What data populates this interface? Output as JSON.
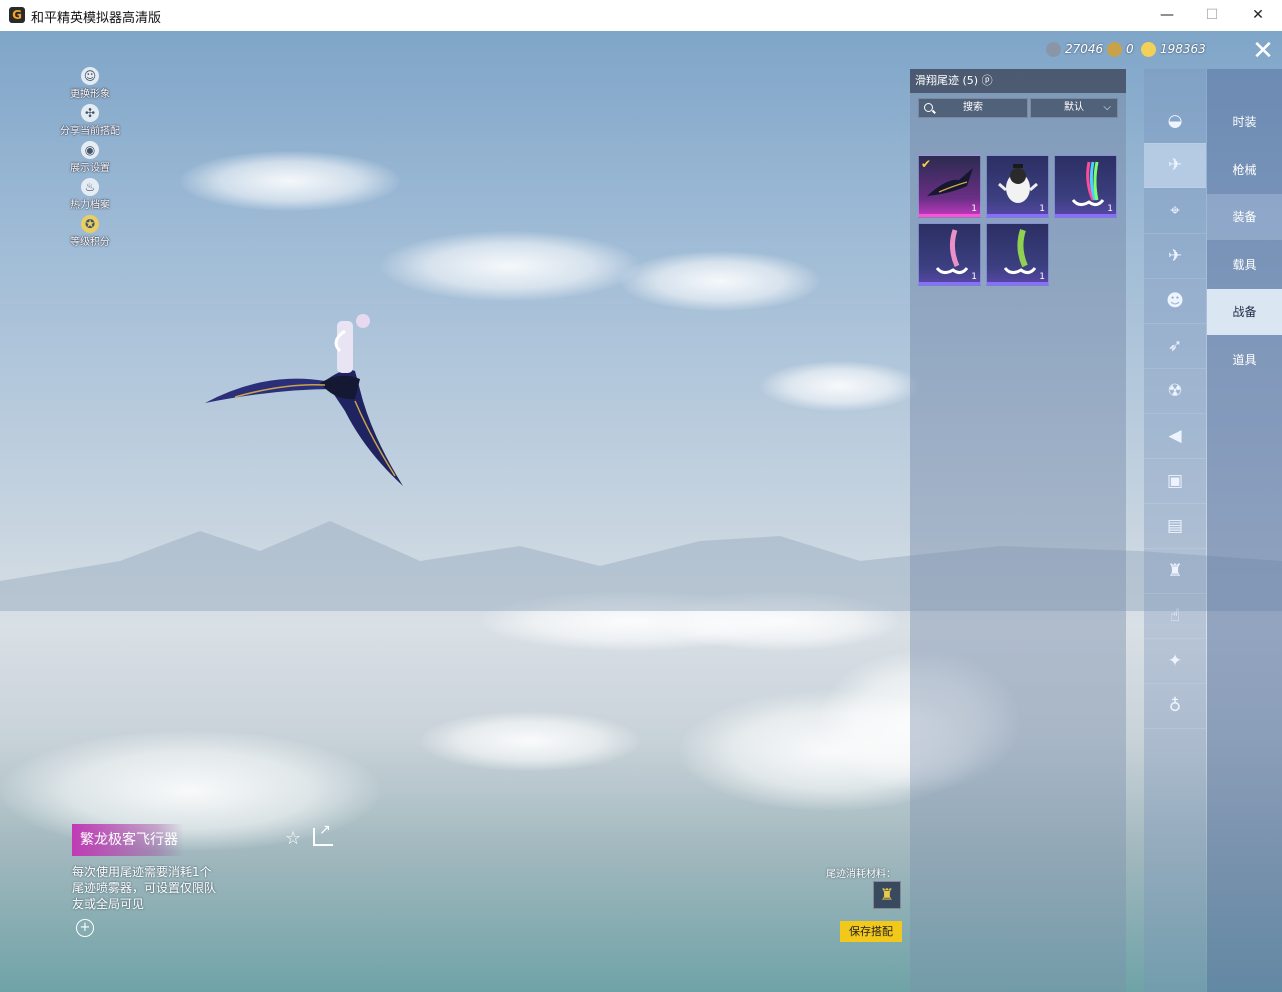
{
  "window": {
    "title": "和平精英模拟器高清版",
    "minimize": "—",
    "maximize": "☐",
    "close": "✕"
  },
  "left_menu": [
    {
      "label": "更换形象",
      "icon": "person-icon",
      "glyph": "☺"
    },
    {
      "label": "分享当前搭配",
      "icon": "share-icon",
      "glyph": "✣"
    },
    {
      "label": "展示设置",
      "icon": "eye-icon",
      "glyph": "◉"
    },
    {
      "label": "热力档案",
      "icon": "flame-icon",
      "glyph": "♨"
    },
    {
      "label": "等级积分",
      "icon": "badge-icon",
      "glyph": "✪"
    }
  ],
  "currency": [
    {
      "value": "27046",
      "color": "#8a96a8"
    },
    {
      "value": "0",
      "color": "#c8a24a"
    },
    {
      "value": "198363",
      "color": "#f1d157"
    }
  ],
  "panel": {
    "title": "滑翔尾迹 (5) ⓟ",
    "search_label": "搜索",
    "sort_label": "默认",
    "sort_chevron": "⌵",
    "items": [
      {
        "count": "1",
        "selected": true,
        "check": "✔"
      },
      {
        "count": "1",
        "selected": false
      },
      {
        "count": "1",
        "selected": false
      },
      {
        "count": "1",
        "selected": false
      },
      {
        "count": "1",
        "selected": false
      }
    ]
  },
  "categories": [
    {
      "icon": "hat-icon",
      "glyph": "◒"
    },
    {
      "icon": "glider-trail-icon",
      "glyph": "✈"
    },
    {
      "icon": "drone-icon",
      "glyph": "⌖"
    },
    {
      "icon": "plane-icon",
      "glyph": "✈"
    },
    {
      "icon": "emote-icon",
      "glyph": "☻"
    },
    {
      "icon": "vehicle-icon",
      "glyph": "➶"
    },
    {
      "icon": "companion-icon",
      "glyph": "☢"
    },
    {
      "icon": "speaker-icon",
      "glyph": "◀"
    },
    {
      "icon": "chat-icon",
      "glyph": "▣"
    },
    {
      "icon": "gallery-icon",
      "glyph": "▤"
    },
    {
      "icon": "extinguisher-icon",
      "glyph": "♜"
    },
    {
      "icon": "tap-icon",
      "glyph": "☝"
    },
    {
      "icon": "sparkle-icon",
      "glyph": "✦"
    },
    {
      "icon": "planet-icon",
      "glyph": "♁"
    }
  ],
  "tabs": [
    "时装",
    "枪械",
    "装备",
    "载具",
    "战备",
    "道具"
  ],
  "close_button": "✕",
  "item_detail": {
    "name": "繁龙极客飞行器",
    "description": "每次使用尾迹需要消耗1个尾迹喷雾器，可设置仅限队友或全局可见",
    "plus": "+",
    "star": "☆"
  },
  "material": {
    "label": "尾迹消耗材料：",
    "icon_glyph": "♜"
  },
  "save_button": "保存搭配"
}
